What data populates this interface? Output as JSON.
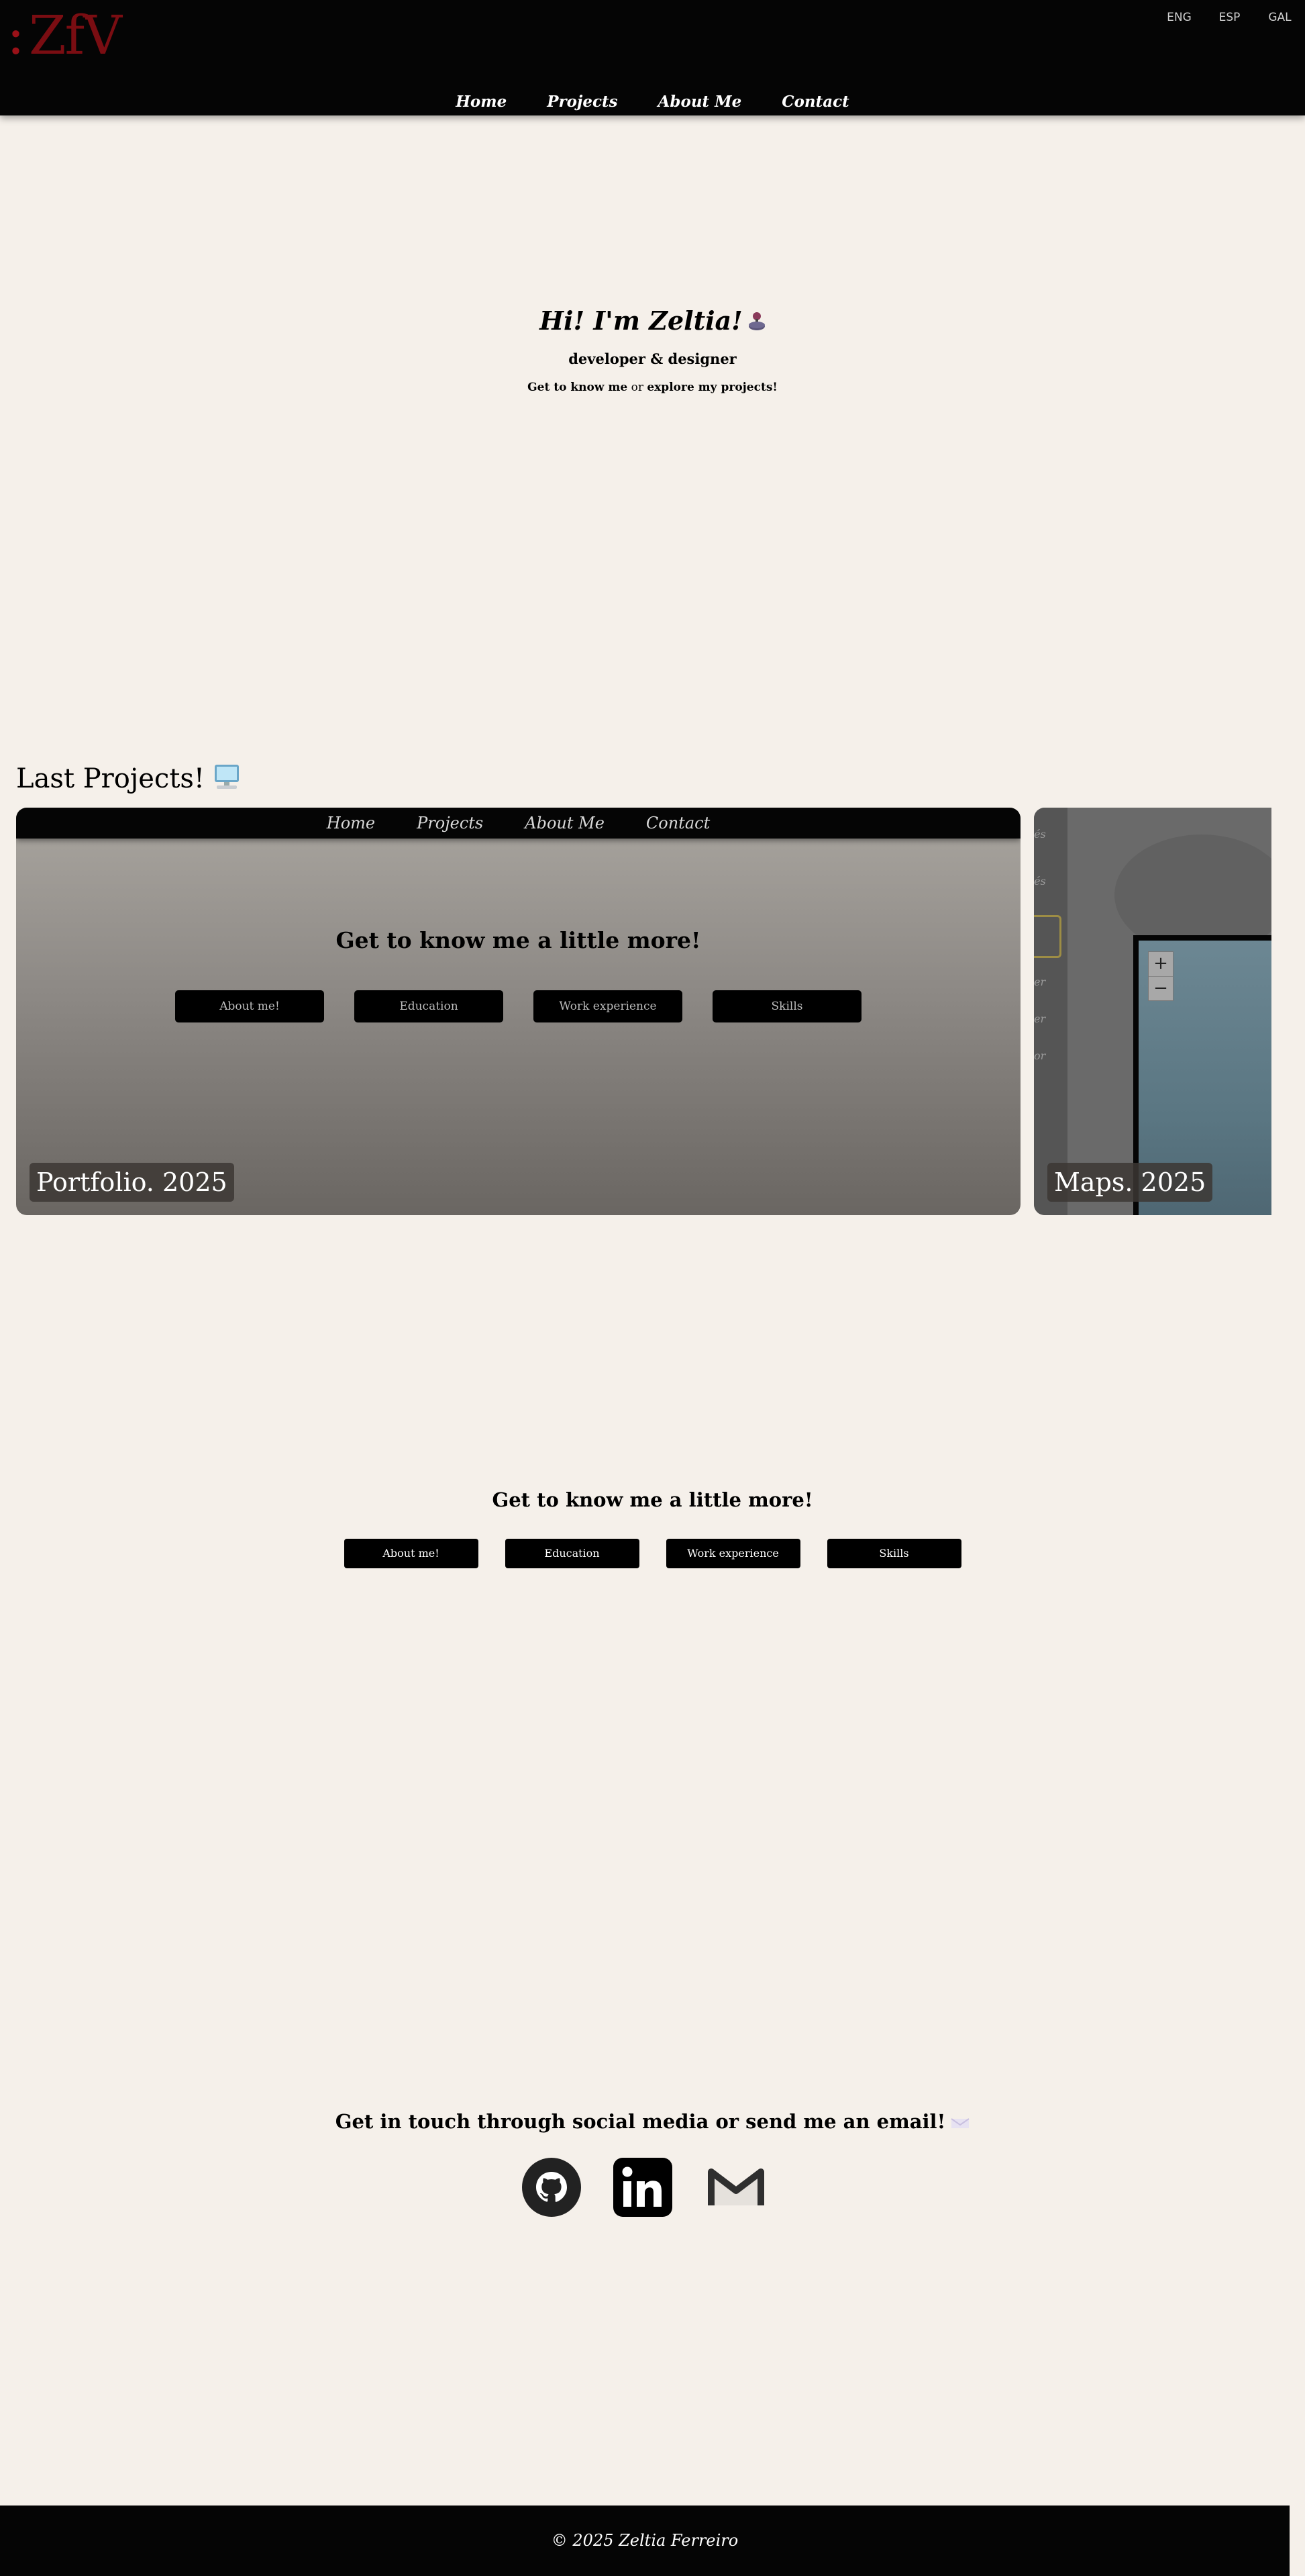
{
  "header": {
    "logo": "ZfV",
    "languages": [
      "ENG",
      "ESP",
      "GAL"
    ],
    "nav": [
      "Home",
      "Projects",
      "About Me",
      "Contact"
    ]
  },
  "hero": {
    "greeting": "Hi! I'm Zeltia!",
    "subtitle": "developer & designer",
    "link_about": "Get to know me",
    "link_or": " or ",
    "link_projects": "explore my projects!"
  },
  "projects": {
    "title": "Last Projects!",
    "cards": [
      {
        "caption": "Portfolio. 2025",
        "nav": [
          "Home",
          "Projects",
          "About Me",
          "Contact"
        ],
        "heading": "Get to know me a little more!",
        "buttons": [
          "About me!",
          "Education",
          "Work experience",
          "Skills"
        ]
      },
      {
        "caption": "Maps. 2025",
        "side_items": [
          "és",
          "és",
          "er",
          "er",
          "or"
        ],
        "zoom_in": "+",
        "zoom_out": "−"
      }
    ]
  },
  "about": {
    "heading": "Get to know me a little more!",
    "buttons": [
      "About me!",
      "Education",
      "Work experience",
      "Skills"
    ]
  },
  "contact": {
    "heading": "Get in touch through social media or send me an email!",
    "icons": [
      "github-icon",
      "linkedin-icon",
      "gmail-icon"
    ]
  },
  "footer": {
    "text": "© 2025 Zeltia Ferreiro"
  },
  "colors": {
    "background": "#f5f0ea",
    "header": "#050505",
    "logo": "#7a0d12"
  }
}
